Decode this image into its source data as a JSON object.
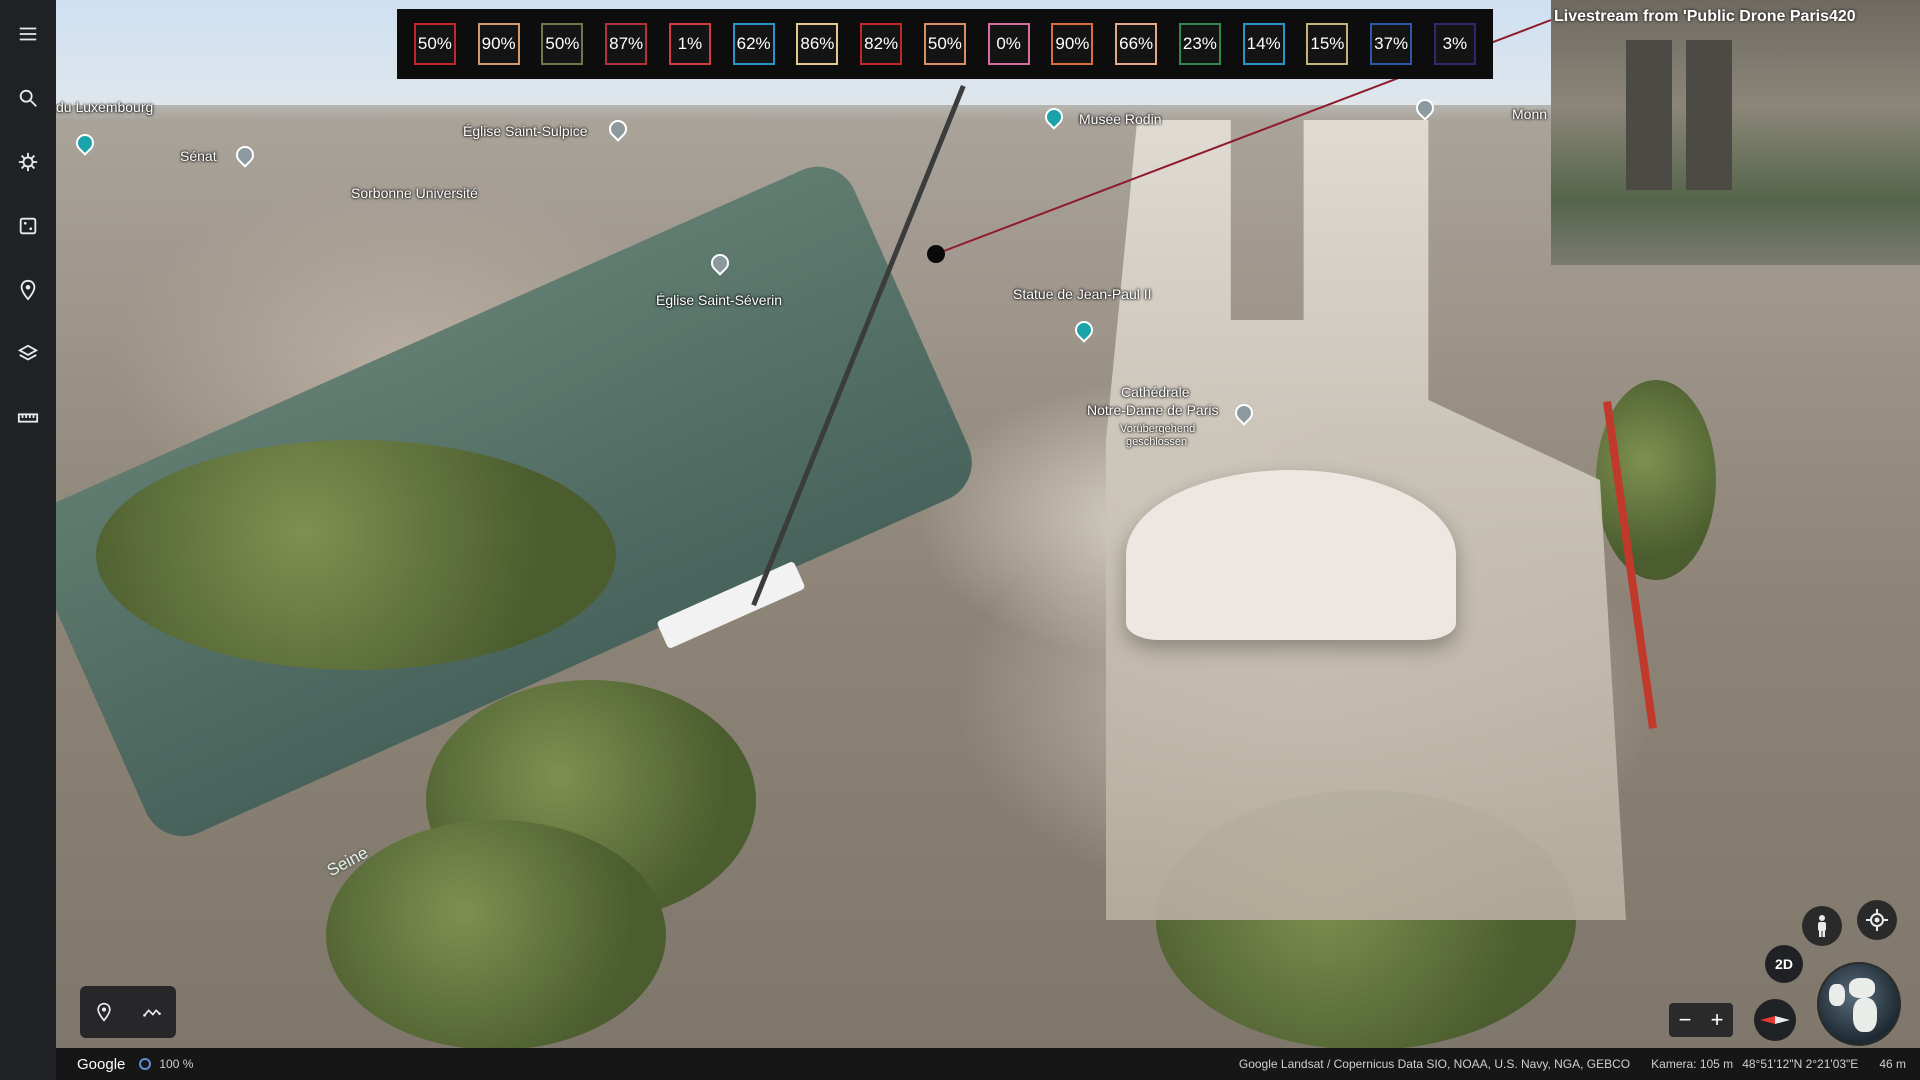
{
  "sidebar": {
    "items": [
      {
        "name": "menu-icon",
        "label": "Menu"
      },
      {
        "name": "search-icon",
        "label": "Search"
      },
      {
        "name": "voyager-icon",
        "label": "Voyager"
      },
      {
        "name": "feeling-lucky-icon",
        "label": "Random location"
      },
      {
        "name": "projects-icon",
        "label": "Projects"
      },
      {
        "name": "map-style-icon",
        "label": "Map style"
      },
      {
        "name": "measure-icon",
        "label": "Measure"
      }
    ]
  },
  "percentages": [
    {
      "text": "50%",
      "color": "#c0262b"
    },
    {
      "text": "90%",
      "color": "#d49a6a"
    },
    {
      "text": "50%",
      "color": "#6a7a4f"
    },
    {
      "text": "87%",
      "color": "#b0323a"
    },
    {
      "text": "1%",
      "color": "#d23b44"
    },
    {
      "text": "62%",
      "color": "#2a96c8"
    },
    {
      "text": "86%",
      "color": "#e3c98e"
    },
    {
      "text": "82%",
      "color": "#c0262b"
    },
    {
      "text": "50%",
      "color": "#d98f62"
    },
    {
      "text": "0%",
      "color": "#d66fa0"
    },
    {
      "text": "90%",
      "color": "#d5703a"
    },
    {
      "text": "66%",
      "color": "#e3a98a"
    },
    {
      "text": "23%",
      "color": "#2f8a4a"
    },
    {
      "text": "14%",
      "color": "#2a96c8"
    },
    {
      "text": "15%",
      "color": "#c9b27a"
    },
    {
      "text": "37%",
      "color": "#2f57a8"
    },
    {
      "text": "3%",
      "color": "#2b2a6e"
    }
  ],
  "livestream": {
    "title": "Livestream from 'Public Drone Paris420"
  },
  "places": {
    "luxembourg": "du Luxembourg",
    "senat": "Sénat",
    "saint_sulpice": "Église Saint-Sulpice",
    "sorbonne": "Sorbonne Université",
    "saint_severin": "Église Saint-Séverin",
    "rodin": "Musée Rodin",
    "jean_paul": "Statue de Jean-Paul II",
    "cathedral_1": "Cathédrale",
    "cathedral_2": "Notre-Dame de Paris",
    "closed_1": "Vorübergehend",
    "closed_2": "geschlossen",
    "monn": "Monn",
    "seine": "Seine"
  },
  "controls": {
    "view_mode": "2D",
    "zoom_out": "−",
    "zoom_in": "+"
  },
  "status": {
    "brand": "Google",
    "loading": "100 %",
    "attribution": "Google  Landsat / Copernicus  Data SIO, NOAA, U.S. Navy, NGA, GEBCO",
    "camera": "Kamera: 105 m",
    "coords": "48°51'12\"N 2°21'03\"E",
    "altitude": "46 m"
  },
  "colors": {
    "sidebar_bg": "#202124",
    "leader_line": "#8e1a2a"
  }
}
